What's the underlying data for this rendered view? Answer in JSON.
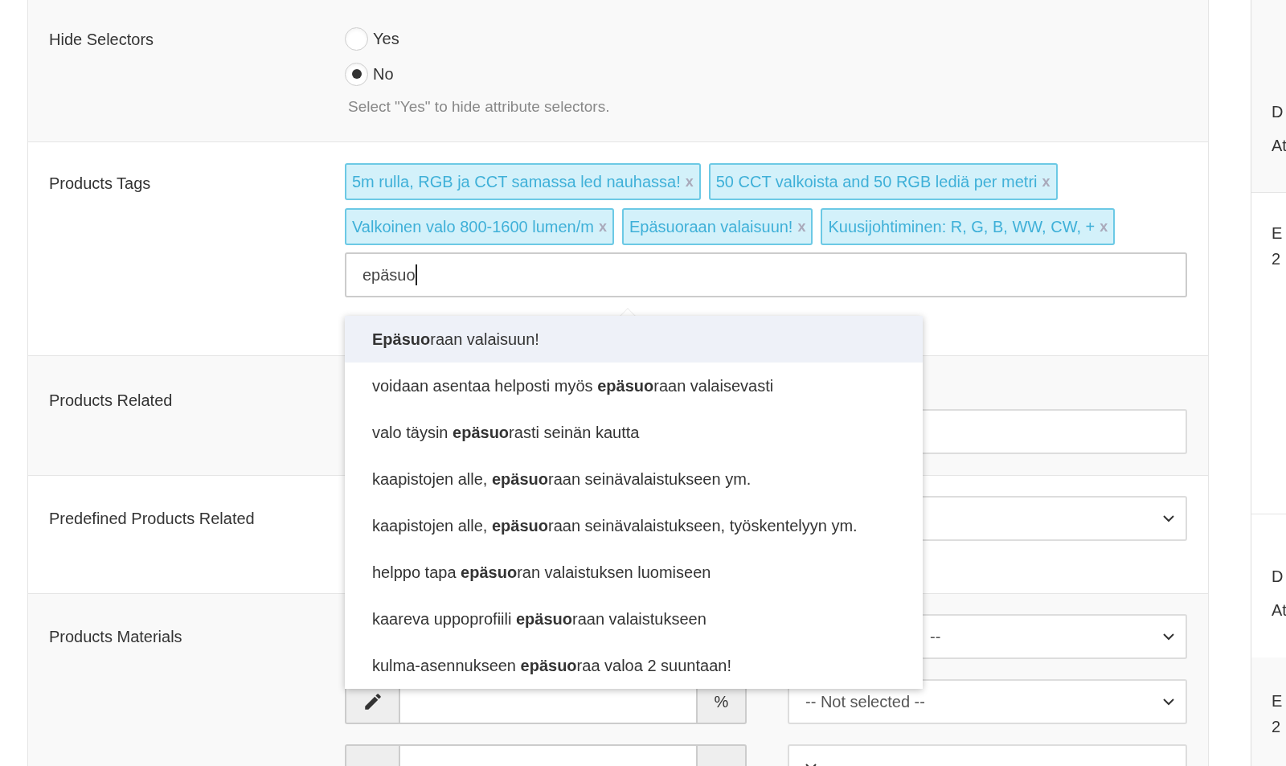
{
  "sections": [
    {
      "kind": "radio",
      "label": "Hide Selectors",
      "options": [
        {
          "label": "Yes",
          "selected": false
        },
        {
          "label": "No",
          "selected": true
        }
      ],
      "help": "Select \"Yes\" to hide attribute selectors."
    },
    {
      "kind": "tags",
      "label": "Products Tags",
      "tags": [
        {
          "text": "5m rulla, RGB ja CCT samassa led nauhassa!",
          "remove": "x"
        },
        {
          "text": "50 CCT valkoista and 50 RGB lediä per metri",
          "remove": "x"
        },
        {
          "text": "Valkoinen valo 800-1600 lumen/m",
          "remove": "x"
        },
        {
          "text": "Epäsuoraan valaisuun!",
          "remove": "x"
        },
        {
          "text": "Kuusijohtiminen: R, G, B, WW, CW, +",
          "remove": "x"
        }
      ],
      "value": "epäsuo",
      "suggestions": [
        {
          "text": "**Epäsuo**raan valaisuun!",
          "selected": true
        },
        {
          "text": "voidaan asentaa helposti myös **epäsuo**raan valaisevasti",
          "selected": false
        },
        {
          "text": "valo täysin **epäsuo**rasti seinän kautta",
          "selected": false
        },
        {
          "text": "kaapistojen alle, **epäsuo**raan seinävalaistukseen ym.",
          "selected": false
        },
        {
          "text": "kaapistojen alle, **epäsuo**raan seinävalaistukseen, työskentelyyn ym.",
          "selected": false
        },
        {
          "text": "helppo tapa **epäsuo**ran valaistuksen luomiseen",
          "selected": false
        },
        {
          "text": "kaareva uppoprofiili **epäsuo**raan valaistukseen",
          "selected": false
        },
        {
          "text": "kulma-asennukseen **epäsuo**raa valoa 2 suuntaan!",
          "selected": false
        }
      ]
    },
    {
      "kind": "input",
      "label": "Products Related"
    },
    {
      "kind": "select",
      "label": "Predefined Products Related"
    },
    {
      "kind": "materials",
      "label": "Products Materials",
      "rows": [
        {
          "select": "--"
        },
        {
          "unit": "%",
          "select": "-- Not selected --"
        },
        {
          "addon": true
        }
      ]
    }
  ],
  "side_panel": [
    {
      "texts": [
        "D",
        "At"
      ]
    },
    {
      "texts": [
        "E",
        "2"
      ]
    },
    {
      "texts": [
        "D",
        "At"
      ]
    },
    {
      "texts": [
        "E",
        "2"
      ]
    }
  ]
}
